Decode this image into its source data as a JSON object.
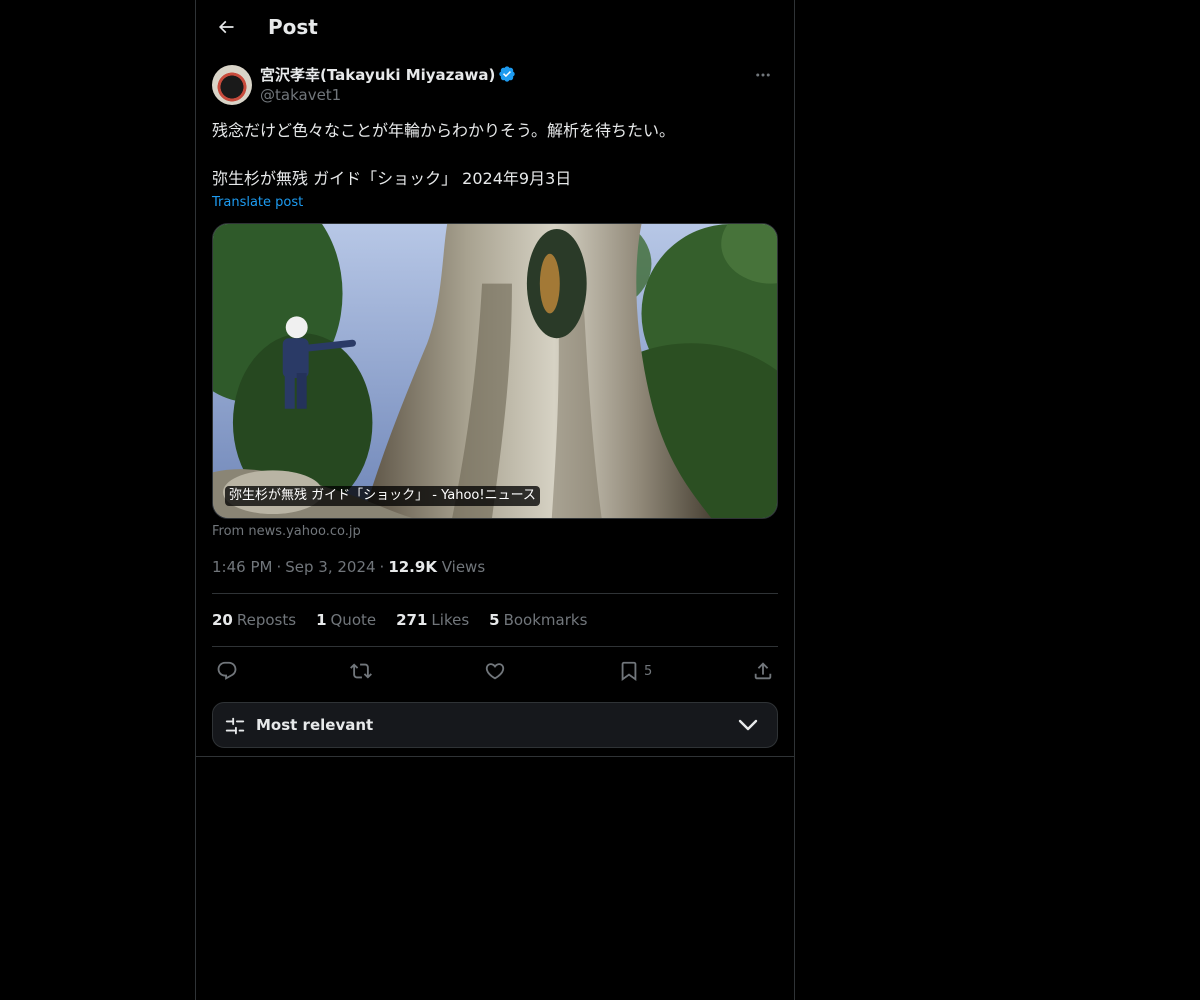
{
  "header": {
    "title": "Post"
  },
  "author": {
    "display_name": "宮沢孝幸(Takayuki Miyazawa)",
    "handle": "@takavet1"
  },
  "post": {
    "text_line1": "残念だけど色々なことが年輪からわかりそう。解析を待ちたい。",
    "text_line2": "弥生杉が無残 ガイド「ショック」 2024年9月3日",
    "translate_label": "Translate post"
  },
  "card": {
    "caption": "弥生杉が無残 ガイド「ショック」 - Yahoo!ニュース",
    "source": "From news.yahoo.co.jp"
  },
  "meta": {
    "time": "1:46 PM",
    "date": "Sep 3, 2024",
    "views_count": "12.9K",
    "views_label": "Views"
  },
  "stats": {
    "reposts_count": "20",
    "reposts_label": "Reposts",
    "quotes_count": "1",
    "quotes_label": "Quote",
    "likes_count": "271",
    "likes_label": "Likes",
    "bookmarks_count": "5",
    "bookmarks_label": "Bookmarks"
  },
  "actions": {
    "bookmark_count": "5",
    "icons": [
      "reply-icon",
      "repost-icon",
      "like-icon",
      "bookmark-icon",
      "share-icon"
    ]
  },
  "sort": {
    "label": "Most relevant"
  },
  "colors": {
    "background": "#000000",
    "text_primary": "#e7e9ea",
    "text_secondary": "#71767b",
    "accent": "#1d9bf0",
    "border": "#2f3336"
  }
}
